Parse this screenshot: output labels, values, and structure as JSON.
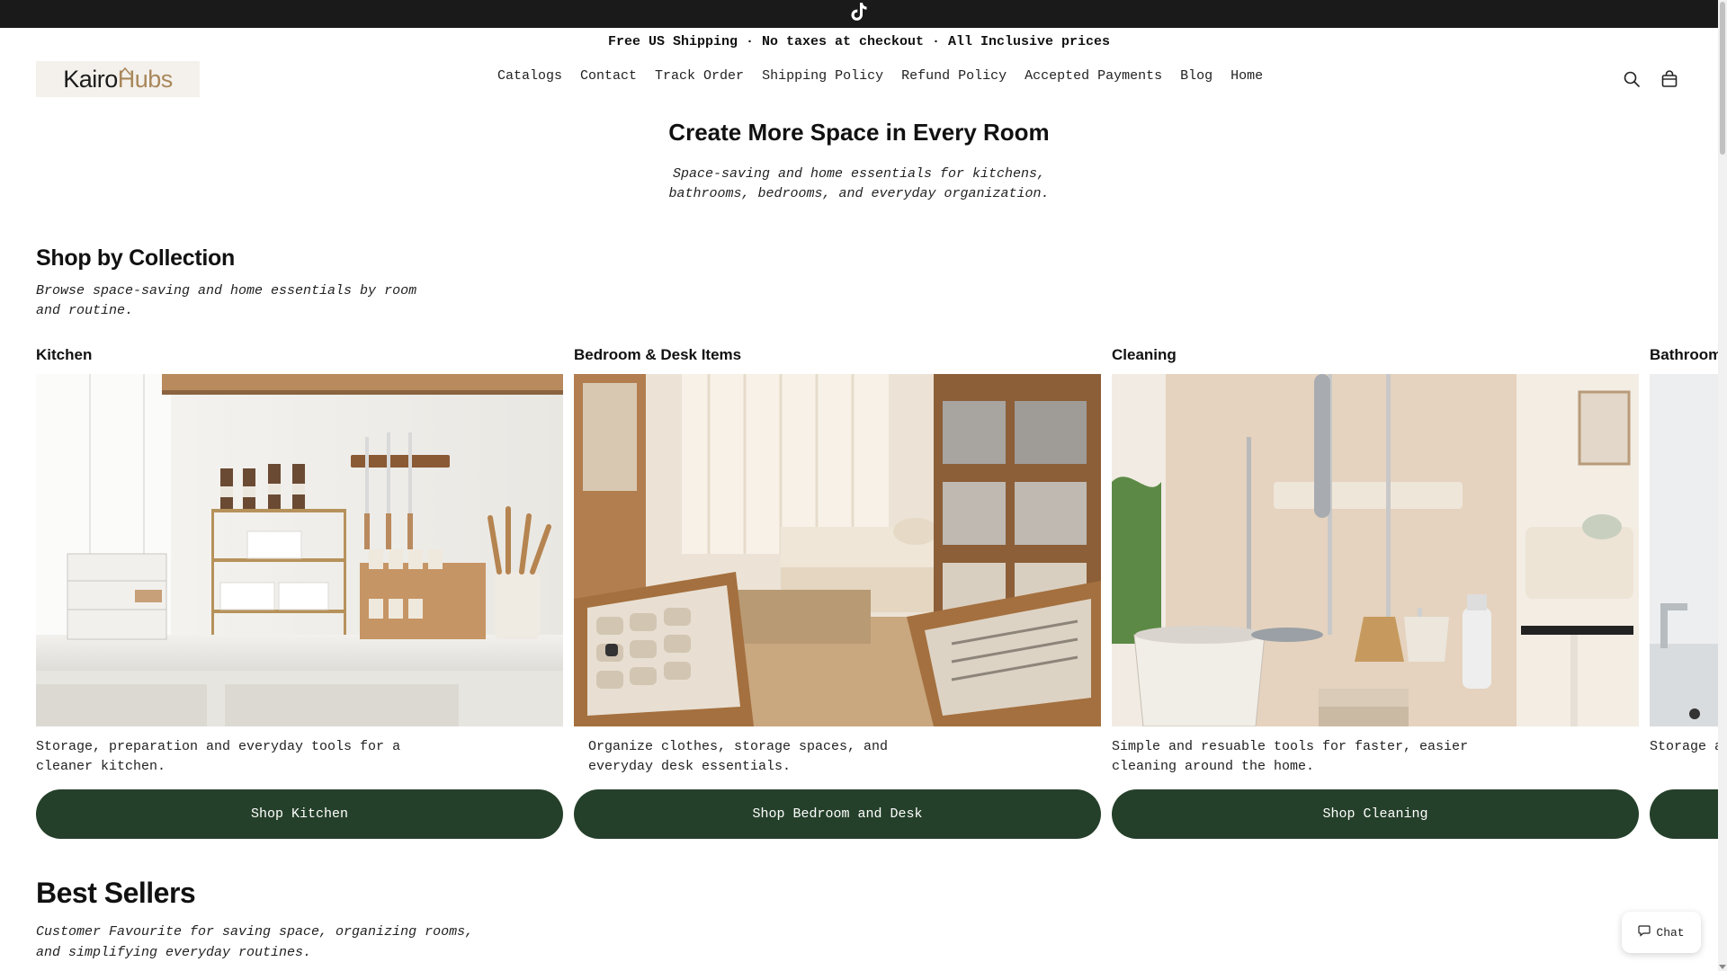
{
  "announcement": "Free US Shipping · No taxes at checkout · All Inclusive prices",
  "brand": {
    "part1": "Kairo",
    "part2": "Hubs",
    "accent_color": "#a9875a"
  },
  "nav": {
    "items": [
      {
        "label": "Catalogs"
      },
      {
        "label": "Contact"
      },
      {
        "label": "Track Order"
      },
      {
        "label": "Shipping Policy"
      },
      {
        "label": "Refund Policy"
      },
      {
        "label": "Accepted Payments"
      },
      {
        "label": "Blog"
      },
      {
        "label": "Home"
      }
    ]
  },
  "icons": {
    "top": "tiktok-icon",
    "search": "search-icon",
    "cart": "bag-icon",
    "chat": "chat-bubble-icon"
  },
  "hero": {
    "title": "Create More Space in Every Room",
    "subtitle": "Space-saving and home essentials for kitchens, bathrooms, bedrooms, and everyday organization."
  },
  "collections": {
    "title": "Shop by Collection",
    "subtitle": "Browse space-saving and home essentials by room and routine.",
    "items": [
      {
        "title": "Kitchen",
        "desc": "Storage, preparation and everyday tools for a cleaner kitchen.",
        "button": "Shop Kitchen"
      },
      {
        "title": "Bedroom & Desk Items",
        "desc": "Organize clothes, storage spaces, and everyday desk essentials.",
        "button": "Shop Bedroom and Desk"
      },
      {
        "title": "Cleaning",
        "desc": "Simple and resuable tools for faster, easier cleaning around the home.",
        "button": "Shop Cleaning"
      },
      {
        "title": "Bathroom",
        "desc": "Storage a organized",
        "button": ""
      }
    ]
  },
  "best_sellers": {
    "title": "Best Sellers",
    "subtitle": "Customer Favourite for saving space, organizing rooms, and simplifying everyday routines."
  },
  "chat": {
    "label": "Chat"
  },
  "colors": {
    "button_bg": "#25402a",
    "topbar_bg": "#1a1a1a"
  }
}
